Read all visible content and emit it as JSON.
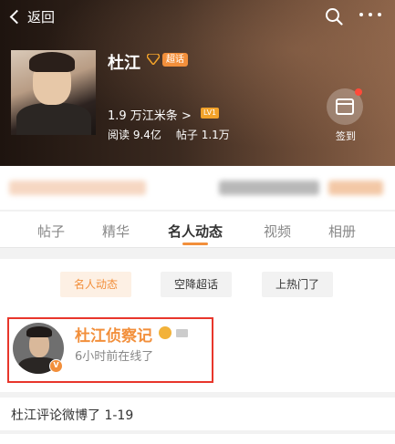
{
  "header": {
    "back_label": "返回",
    "title_name": "杜江",
    "badge_label": "超话",
    "fans_text": "1.9 万江米条 >",
    "level_badge": "LV1",
    "read_count": "阅读 9.4亿",
    "post_count": "帖子 1.1万",
    "checkin_label": "签到"
  },
  "tabs": [
    {
      "label": "帖子"
    },
    {
      "label": "精华"
    },
    {
      "label": "名人动态"
    },
    {
      "label": "视频"
    },
    {
      "label": "相册"
    }
  ],
  "chips": [
    {
      "label": "名人动态"
    },
    {
      "label": "空降超话"
    },
    {
      "label": "上热门了"
    }
  ],
  "user_card": {
    "name": "杜江侦察记",
    "status": "6小时前在线了",
    "verify_mark": "V"
  },
  "section": {
    "title": "杜江评论微博了 1-19"
  },
  "colors": {
    "accent": "#f28f3b",
    "highlight_border": "#e8362b"
  }
}
